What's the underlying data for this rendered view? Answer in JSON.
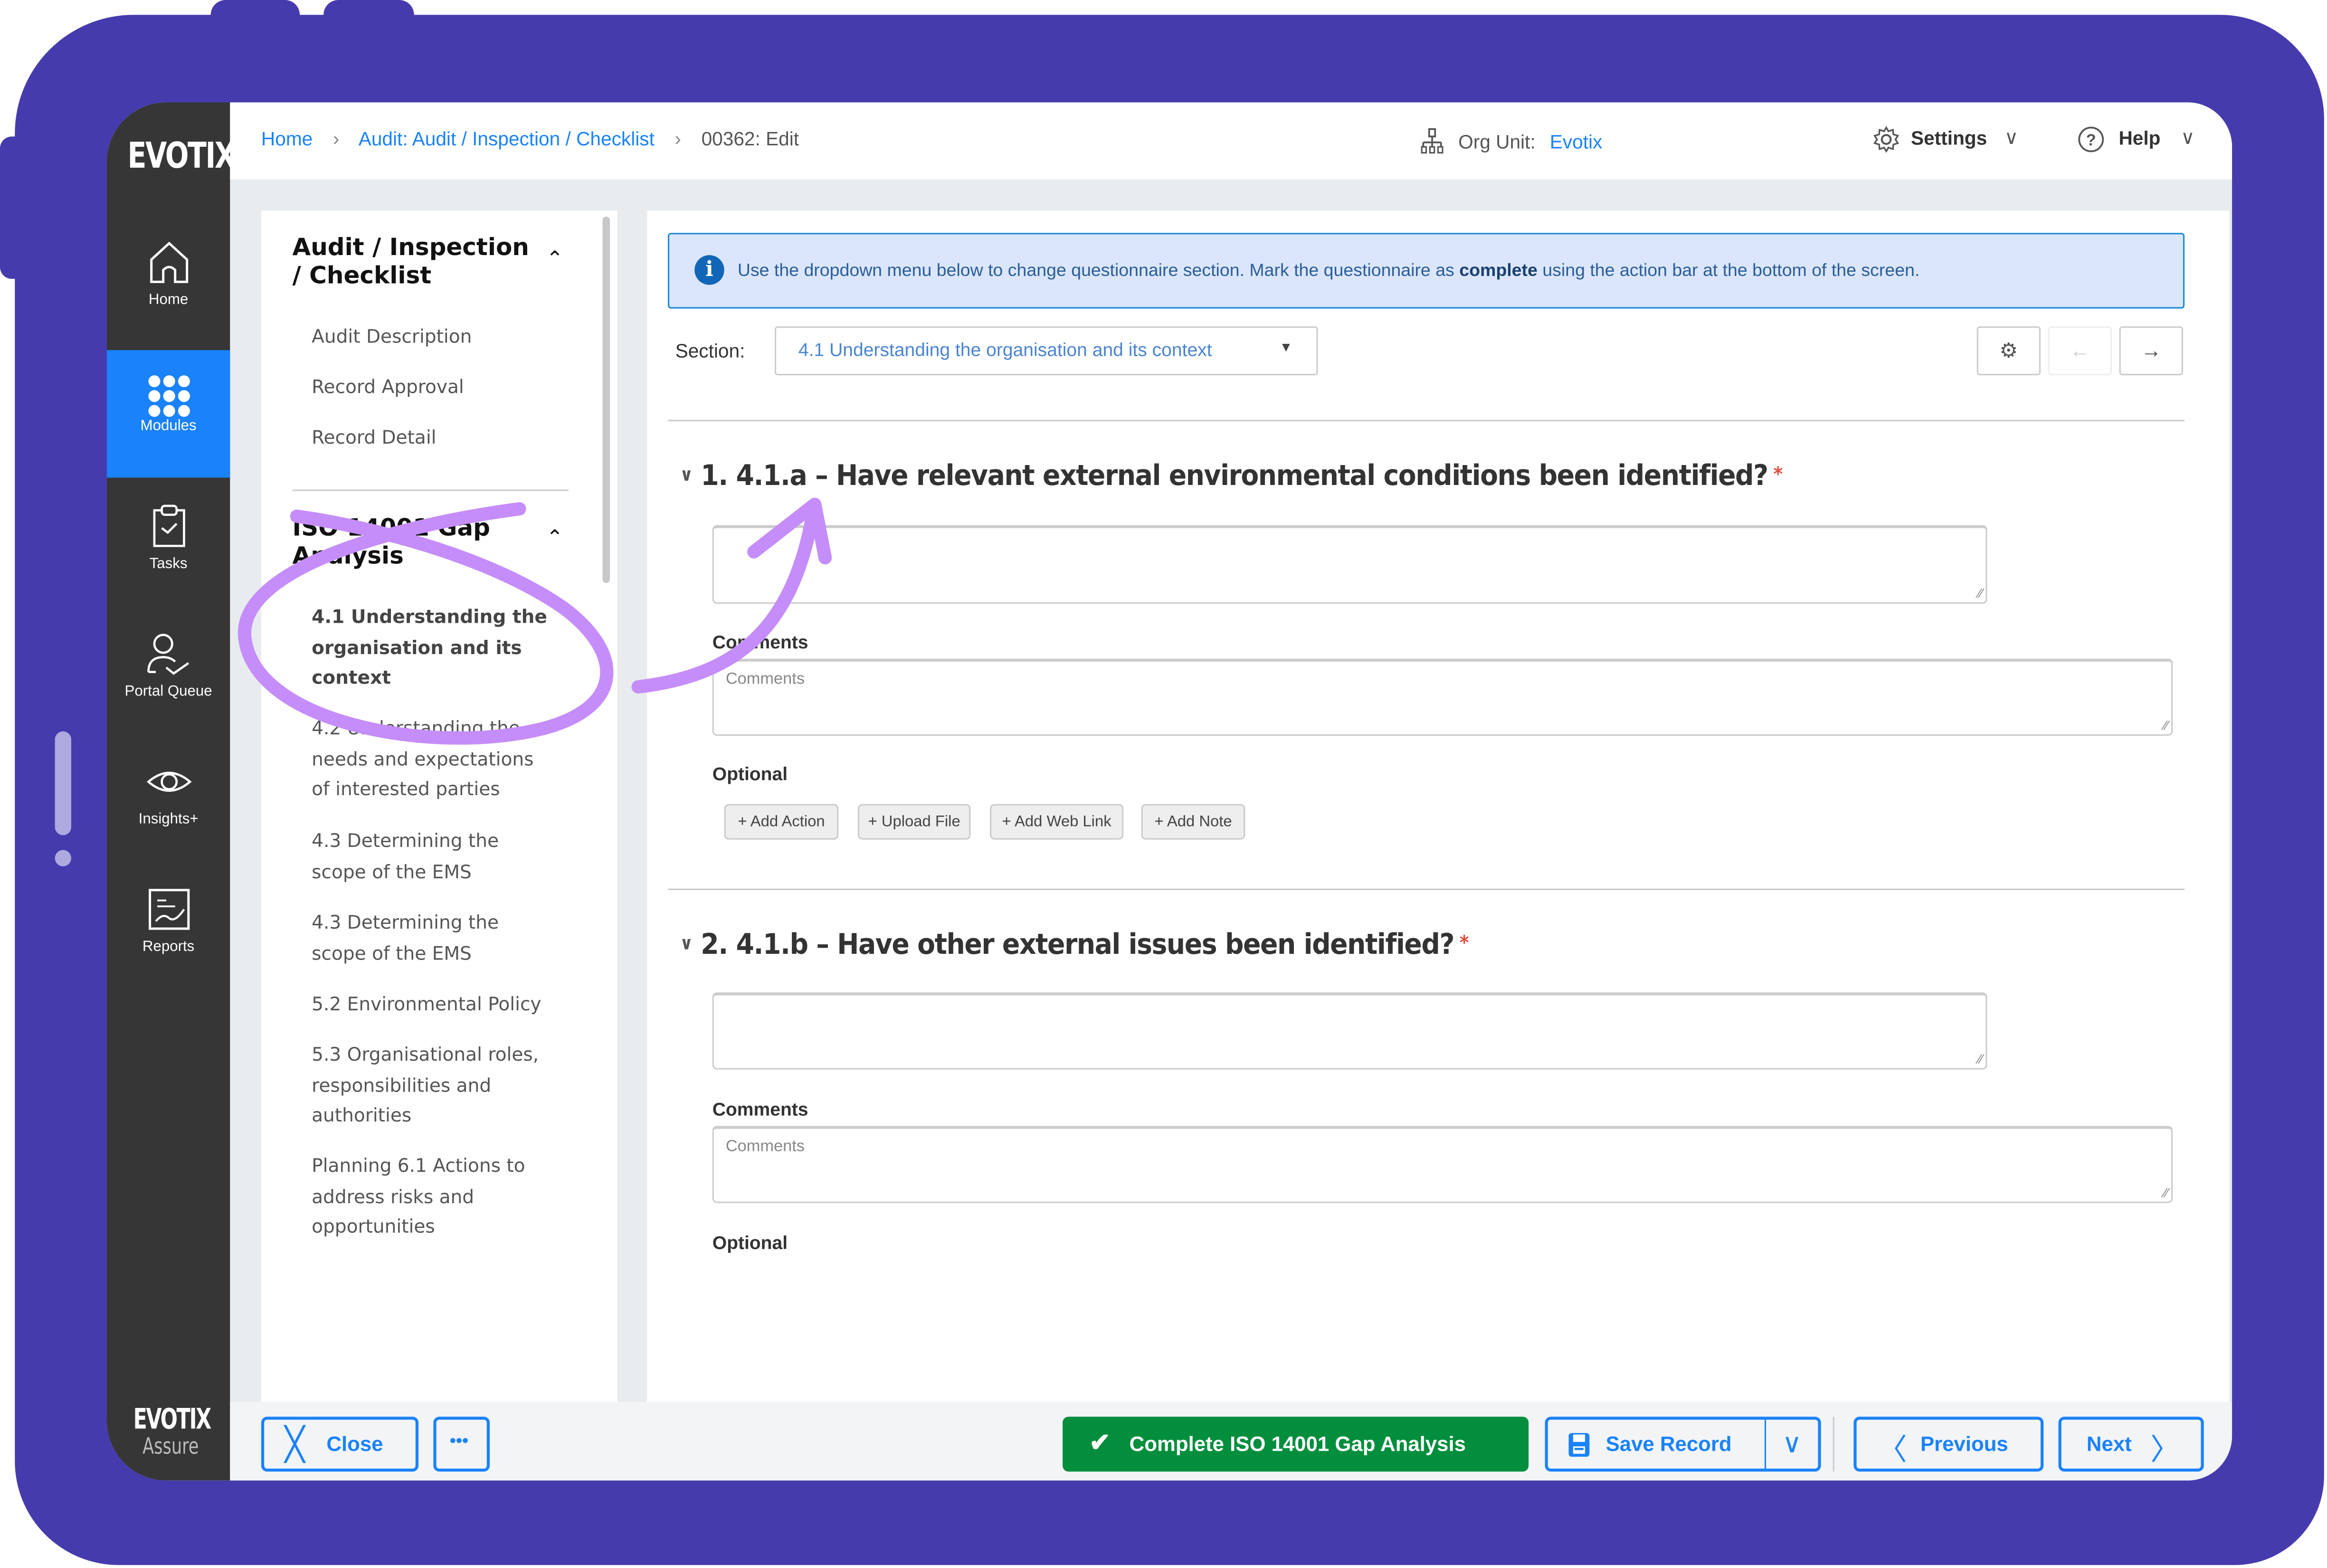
{
  "brand": {
    "logo": "EVOTIX",
    "bottom_logo": "EVOTIX",
    "bottom_product": "Assure"
  },
  "rail": {
    "items": [
      {
        "label": "Home",
        "icon": "home-icon",
        "active": false
      },
      {
        "label": "Modules",
        "icon": "grid-icon",
        "active": true
      },
      {
        "label": "Tasks",
        "icon": "clipboard-check-icon",
        "active": false
      },
      {
        "label": "Portal Queue",
        "icon": "user-check-icon",
        "active": false
      },
      {
        "label": "Insights+",
        "icon": "eye-icon",
        "active": false
      },
      {
        "label": "Reports",
        "icon": "report-chart-icon",
        "active": false
      }
    ]
  },
  "header": {
    "breadcrumb": [
      "Home",
      "Audit: Audit / Inspection / Checklist",
      "00362: Edit"
    ],
    "org_unit_label": "Org Unit:",
    "org_unit_value": "Evotix",
    "settings_label": "Settings",
    "help_label": "Help"
  },
  "nav": {
    "groups": [
      {
        "title_line1": "Audit / Inspection",
        "title_line2": "/ Checklist",
        "items": [
          "Audit Description",
          "Record Approval",
          "Record Detail"
        ]
      },
      {
        "title_line1": "ISO 14001 Gap",
        "title_line2": "Analysis",
        "items": [
          {
            "line1": "4.1 Understanding the",
            "line2": "organisation and its",
            "line3": "context",
            "active": true
          },
          {
            "line1": "4.2 Understanding the",
            "line2": "needs and expectations",
            "line3": "of interested parties"
          },
          {
            "line1": "4.3 Determining the",
            "line2": "scope of the EMS"
          },
          {
            "line1": "4.3 Determining the",
            "line2": "scope of the EMS"
          },
          {
            "line1": "5.2 Environmental Policy"
          },
          {
            "line1": "5.3 Organisational roles,",
            "line2": "responsibilities and",
            "line3": "authorities"
          },
          {
            "line1": "Planning 6.1 Actions to",
            "line2": "address risks and",
            "line3": "opportunities"
          }
        ]
      }
    ]
  },
  "main": {
    "info_prefix": "Use the dropdown menu below to change questionnaire section. Mark the questionnaire as ",
    "info_bold": "complete",
    "info_suffix": " using the action bar at the bottom of the screen.",
    "section_label": "Section:",
    "section_value": "4.1 Understanding the organisation and its context",
    "questions": [
      {
        "title": "1. 4.1.a – Have relevant external environmental conditions been identified?",
        "required_mark": "*",
        "answer_value": "",
        "comments_label": "Comments",
        "comments_placeholder": "Comments",
        "optional_label": "Optional",
        "optional_buttons": [
          "+ Add Action",
          "+ Upload File",
          "+ Add Web Link",
          "+ Add Note"
        ]
      },
      {
        "title": "2. 4.1.b – Have other external issues been identified?",
        "required_mark": "*",
        "answer_value": "",
        "comments_label": "Comments",
        "comments_placeholder": "Comments",
        "optional_label": "Optional"
      }
    ]
  },
  "actionbar": {
    "close_label": "Close",
    "more_label": "•••",
    "complete_label": "Complete ISO 14001 Gap Analysis",
    "save_label": "Save Record",
    "previous_label": "Previous",
    "next_label": "Next"
  },
  "colors": {
    "frame": "#463bad",
    "accent": "#1a82fb",
    "complete": "#038e3d",
    "annotation": "#c58df9",
    "required": "#e04e3a"
  }
}
